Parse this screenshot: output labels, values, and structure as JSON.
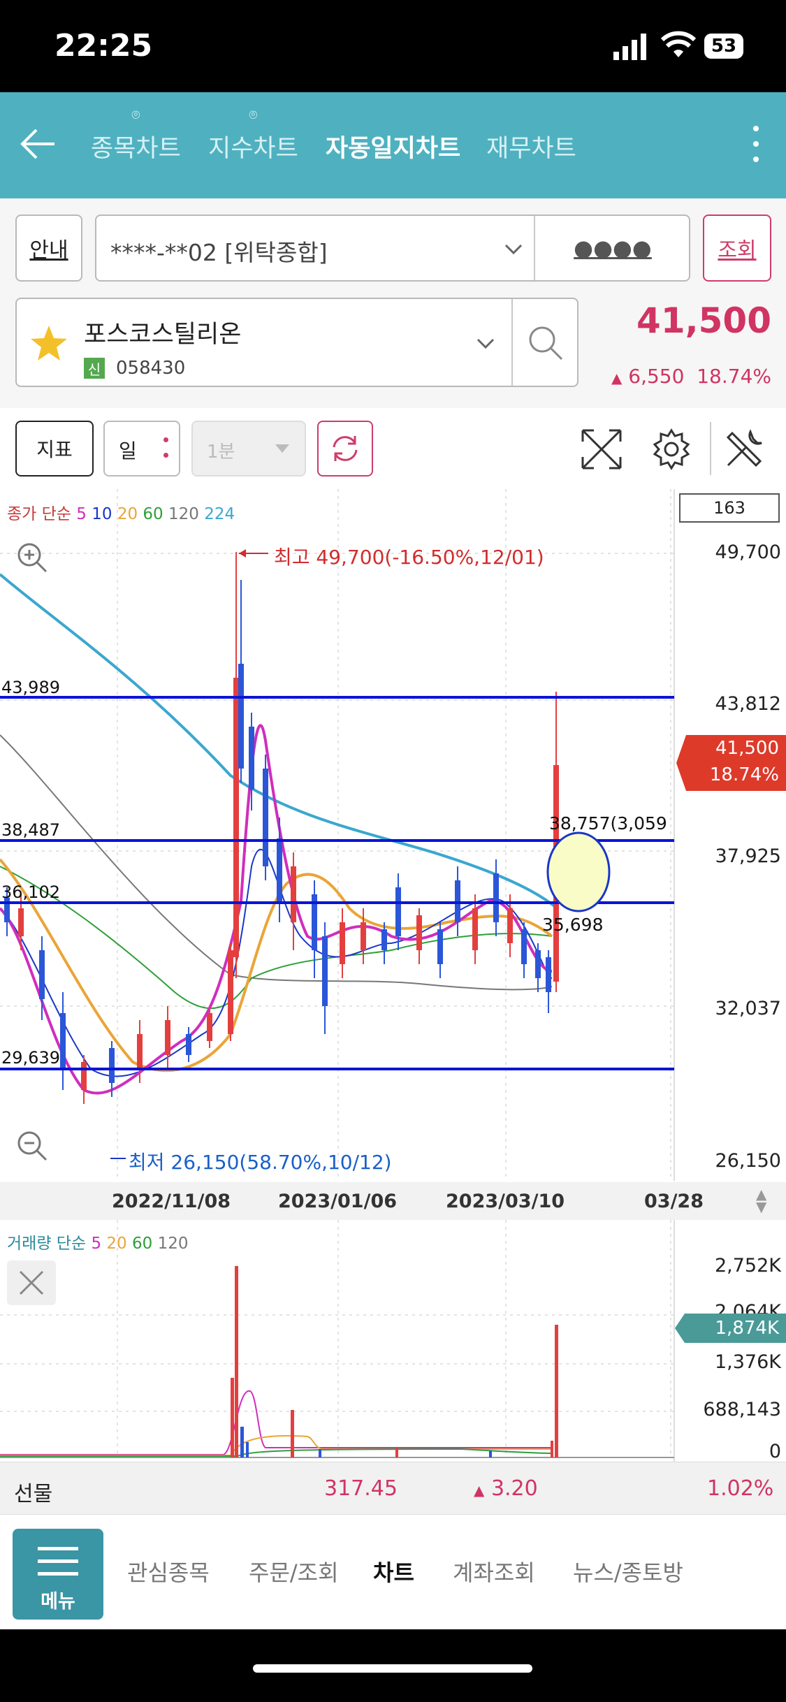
{
  "status_bar": {
    "time": "22:25",
    "battery": "53"
  },
  "nav": {
    "tabs": [
      {
        "label": "종목차트",
        "pinned": true
      },
      {
        "label": "지수차트",
        "pinned": true
      },
      {
        "label": "자동일지차트",
        "active": true
      },
      {
        "label": "재무차트"
      }
    ]
  },
  "account": {
    "guide_label": "안내",
    "account_value": "****-**02 [위탁종합]",
    "password_mask": "●●●●",
    "query_label": "조회"
  },
  "stock": {
    "name": "포스코스틸리온",
    "badge": "신",
    "code": "058430",
    "price": "41,500",
    "change": "6,550",
    "change_pct": "18.74%"
  },
  "toolbar": {
    "indicator_label": "지표",
    "period_label": "일",
    "interval_label": "1분"
  },
  "chart_header": {
    "ma_legend_prefix": "종가 단순",
    "ma": [
      {
        "p": "5",
        "color": "#d02dbd"
      },
      {
        "p": "10",
        "color": "#1a37c7"
      },
      {
        "p": "20",
        "color": "#eaa537"
      },
      {
        "p": "60",
        "color": "#2e9f3a"
      },
      {
        "p": "120",
        "color": "#777777"
      },
      {
        "p": "224",
        "color": "#3ba7cf"
      }
    ],
    "count_box": "163"
  },
  "price_axis": [
    "49,700",
    "43,812",
    "37,925",
    "32,037",
    "26,150"
  ],
  "current_tag": {
    "price": "41,500",
    "pct": "18.74%"
  },
  "annotations": {
    "high": "최고 49,700(-16.50%,12/01)",
    "low": "최저 26,150(58.70%,10/12)",
    "h1": "43,989",
    "h2": "38,487",
    "h3": "36,102",
    "h4": "29,639",
    "mark_upper": "38,757(3,059",
    "mark_lower": "35,698"
  },
  "x_axis": [
    "2022/11/08",
    "2023/01/06",
    "2023/03/10",
    "03/28"
  ],
  "volume": {
    "legend_prefix": "거래량 단순",
    "ma": [
      {
        "p": "5",
        "color": "#d02dbd"
      },
      {
        "p": "20",
        "color": "#eaa537"
      },
      {
        "p": "60",
        "color": "#2e9f3a"
      },
      {
        "p": "120",
        "color": "#777777"
      }
    ],
    "axis": [
      "2,752K",
      "2,064K",
      "1,376K",
      "688,143",
      "0"
    ],
    "current_tag": "1,874K"
  },
  "futures": {
    "label": "선물",
    "value": "317.45",
    "change": "3.20",
    "pct": "1.02%"
  },
  "bottom_nav": {
    "menu_label": "메뉴",
    "items": [
      "관심종목",
      "주문/조회",
      "차트",
      "계좌조회",
      "뉴스/종토방"
    ],
    "active_index": 2
  },
  "colors": {
    "accent": "#4fb1c0",
    "up": "#e43f3f",
    "down": "#2b56d8",
    "hline": "#0a14d6",
    "pink": "#d03463"
  }
}
